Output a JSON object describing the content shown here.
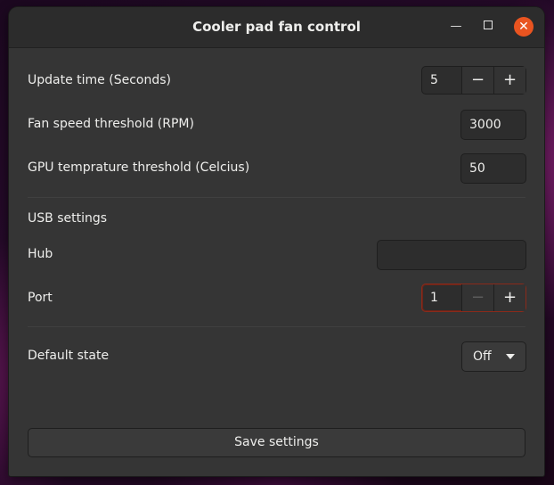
{
  "window": {
    "title": "Cooler pad fan control",
    "minimize_symbol": "—",
    "close_symbol": "✕"
  },
  "fields": {
    "update_time": {
      "label": "Update time (Seconds)",
      "value": "5",
      "minus": "−",
      "plus": "+"
    },
    "fan_speed": {
      "label": "Fan speed threshold (RPM)",
      "value": "3000"
    },
    "gpu_temp": {
      "label": "GPU temprature threshold (Celcius)",
      "value": "50"
    }
  },
  "usb": {
    "section_label": "USB settings",
    "hub": {
      "label": "Hub",
      "value": ""
    },
    "port": {
      "label": "Port",
      "value": "1",
      "minus": "−",
      "plus": "+",
      "minus_disabled": true
    }
  },
  "default_state": {
    "label": "Default state",
    "selected": "Off"
  },
  "save_button": {
    "label": "Save settings"
  },
  "colors": {
    "accent": "#e95420",
    "window_bg": "#353535",
    "titlebar_bg": "#2c2c2c"
  }
}
